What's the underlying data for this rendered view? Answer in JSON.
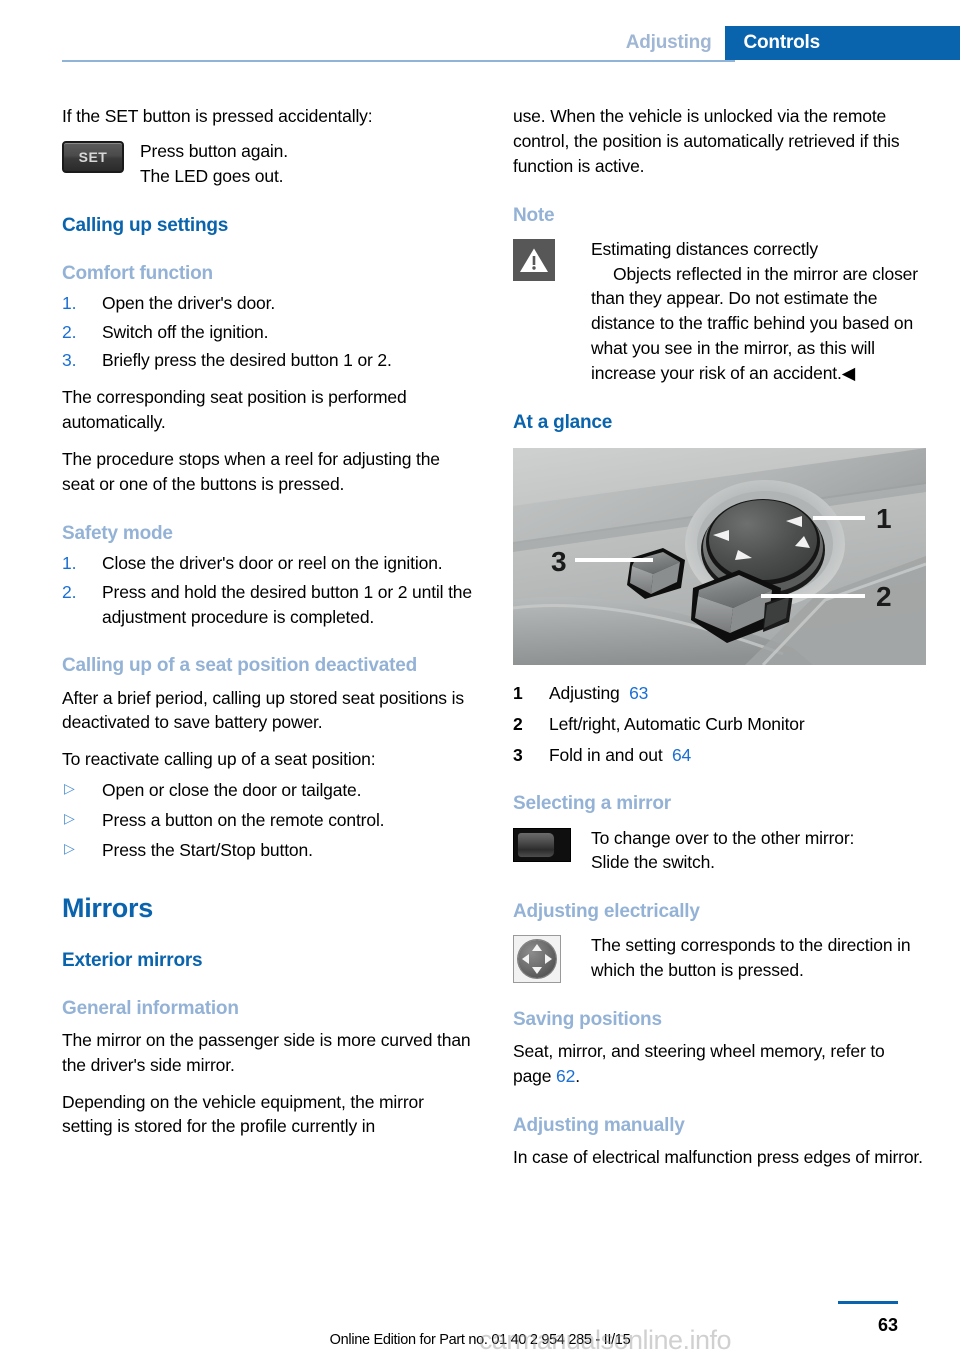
{
  "header": {
    "chapter": "Adjusting",
    "section": "Controls"
  },
  "left_column": {
    "intro_line": "If the SET button is pressed accidentally:",
    "set_block": {
      "icon": "set-button-icon",
      "icon_label": "SET",
      "line1": "Press button again.",
      "line2": "The LED goes out."
    },
    "heading_calling_up_settings": "Calling up settings",
    "heading_comfort_function": "Comfort function",
    "comfort_steps": [
      "Open the driver's door.",
      "Switch off the ignition.",
      "Briefly press the desired button 1 or 2."
    ],
    "comfort_para1": "The corresponding seat position is performed automatically.",
    "comfort_para2": "The procedure stops when a reel for adjusting the seat or one of the buttons is pressed.",
    "heading_safety_mode": "Safety mode",
    "safety_steps": [
      "Close the driver's door or reel on the ignition.",
      "Press and hold the desired button 1 or 2 until the adjustment procedure is completed."
    ],
    "heading_calling_up_deactivated": "Calling up of a seat position deactivated",
    "deactivated_para1": "After a brief period, calling up stored seat positions is deactivated to save battery power.",
    "deactivated_para2": "To reactivate calling up of a seat position:",
    "reactivate_bullets": [
      "Open or close the door or tailgate.",
      "Press a button on the remote control.",
      "Press the Start/Stop button."
    ],
    "heading_mirrors": "Mirrors",
    "heading_exterior_mirrors": "Exterior mirrors",
    "heading_general_information": "General information",
    "general_para1": "The mirror on the passenger side is more curved than the driver's side mirror.",
    "general_para2": "Depending on the vehicle equipment, the mirror setting is stored for the profile currently in"
  },
  "right_column": {
    "continued_para": "use. When the vehicle is unlocked via the remote control, the position is automatically retrieved if this function is active.",
    "heading_note": "Note",
    "note_block": {
      "icon": "warning-triangle-icon",
      "title": "Estimating distances correctly",
      "body": "Objects reflected in the mirror are closer than they appear. Do not estimate the distance to the traffic behind you based on what you see in the mirror, as this will increase your risk of an accident.",
      "end_marker": "◀"
    },
    "heading_at_a_glance": "At a glance",
    "illustration": {
      "name": "mirror-controls-illustration",
      "callouts": [
        "1",
        "2",
        "3"
      ]
    },
    "legend": [
      {
        "num": "1",
        "label": "Adjusting",
        "page": "63"
      },
      {
        "num": "2",
        "label": "Left/right, Automatic Curb Monitor",
        "page": ""
      },
      {
        "num": "3",
        "label": "Fold in and out",
        "page": "64"
      }
    ],
    "heading_selecting_a_mirror": "Selecting a mirror",
    "selecting_block": {
      "icon": "slide-switch-icon",
      "line1": "To change over to the other mirror:",
      "line2": "Slide the switch."
    },
    "heading_adjusting_electrically": "Adjusting electrically",
    "adjusting_block": {
      "icon": "joystick-icon",
      "text": "The setting corresponds to the direction in which the button is pressed."
    },
    "heading_saving_positions": "Saving positions",
    "saving_para_before": "Seat, mirror, and steering wheel memory, refer to page ",
    "saving_page": "62",
    "saving_para_after": ".",
    "heading_adjusting_manually": "Adjusting manually",
    "manually_para": "In case of electrical malfunction press edges of mirror."
  },
  "footer": {
    "edition": "Online Edition for Part no. 01 40 2 954 285 - II/15",
    "page_number": "63",
    "watermark": "carmanualsonline.info"
  },
  "colors": {
    "accent_blue": "#0a64ad",
    "light_blue": "#93b2d6",
    "link_blue": "#1a6fd4"
  }
}
